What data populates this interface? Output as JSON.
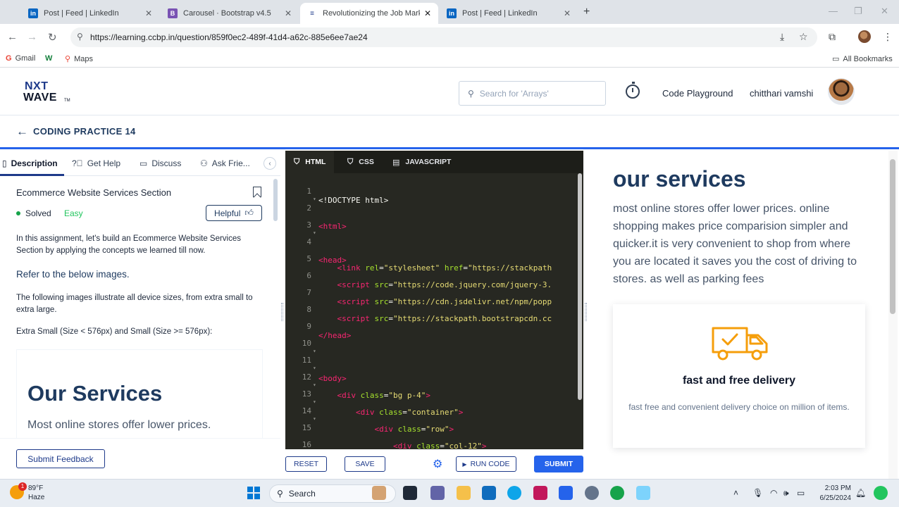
{
  "browser": {
    "tabs": [
      {
        "label": "Post | Feed | LinkedIn",
        "icon": "linkedin-icon",
        "active": false
      },
      {
        "label": "Carousel · Bootstrap v4.5",
        "icon": "bootstrap-icon",
        "active": false
      },
      {
        "label": "Revolutionizing the Job Market",
        "icon": "ccbp-icon",
        "active": true
      },
      {
        "label": "Post | Feed | LinkedIn",
        "icon": "linkedin-icon",
        "active": false
      }
    ],
    "url": "https://learning.ccbp.in/question/859f0ec2-489f-41d4-a62c-885e6ee7ae24",
    "bookmarks": [
      {
        "label": "Gmail",
        "icon": "gmail-icon"
      },
      {
        "label": "Maps",
        "icon": "maps-icon"
      }
    ],
    "all_bookmarks": "All Bookmarks"
  },
  "site": {
    "logo_line1": "NXT",
    "logo_line2": "WAVE",
    "logo_tm": "TM",
    "search_placeholder": "Search for 'Arrays'",
    "playground": "Code Playground",
    "user_name": "chitthari vamshi"
  },
  "breadcrumb": {
    "title": "CODING PRACTICE 14"
  },
  "left_panel": {
    "tabs": [
      "Description",
      "Get Help",
      "Discuss",
      "Ask Frie..."
    ],
    "problem_title": "Ecommerce Website Services Section",
    "status": "Solved",
    "difficulty": "Easy",
    "helpful": "Helpful",
    "para1": "In this assignment, let's build an Ecommerce Website Services Section by applying the concepts we learned till now.",
    "heading": "Refer to the below images.",
    "para2": "The following images illustrate all device sizes, from extra small to extra large.",
    "para3": "Extra Small (Size < 576px) and Small (Size >= 576px):",
    "preview_heading": "Our Services",
    "preview_text": "Most online stores offer lower prices.",
    "feedback": "Submit Feedback"
  },
  "editor": {
    "tabs": [
      "HTML",
      "CSS",
      "JAVASCRIPT"
    ],
    "line_numbers": [
      "1",
      "2",
      "3",
      "4",
      "5",
      "6",
      "7",
      "8",
      "9",
      "10",
      "11",
      "12",
      "13",
      "14",
      "15",
      "16"
    ],
    "buttons": {
      "reset": "RESET",
      "save": "SAVE",
      "run": "RUN CODE",
      "submit": "SUBMIT"
    }
  },
  "output": {
    "heading": "our services",
    "text": "most online stores offer lower prices. online shopping makes price comparision simpler and quicker.it is very convenient to shop from where you are located it saves you the cost of driving to stores. as well as parking fees",
    "card_title": "fast and free delivery",
    "card_text": "fast free and convenient delivery choice on million of items."
  },
  "taskbar": {
    "temp": "89°F",
    "weather": "Haze",
    "weather_badge": "1",
    "search": "Search",
    "time": "2:03 PM",
    "date": "6/25/2024"
  },
  "colors": {
    "accent": "#2563eb",
    "brand_dark": "#1e3a5f",
    "editor_bg": "#272822",
    "solved": "#16a34a"
  }
}
